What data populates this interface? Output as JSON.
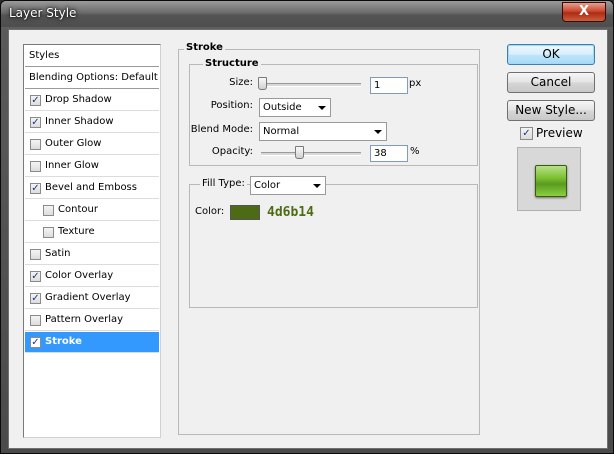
{
  "window": {
    "title": "Layer Style",
    "close_glyph": "X"
  },
  "styles_list": {
    "header": "Styles",
    "items": [
      {
        "label": "Blending Options: Default",
        "has_checkbox": false,
        "checked": false,
        "indent": false,
        "selected": false
      },
      {
        "label": "Drop Shadow",
        "has_checkbox": true,
        "checked": true,
        "indent": false,
        "selected": false
      },
      {
        "label": "Inner Shadow",
        "has_checkbox": true,
        "checked": true,
        "indent": false,
        "selected": false
      },
      {
        "label": "Outer Glow",
        "has_checkbox": true,
        "checked": false,
        "indent": false,
        "selected": false
      },
      {
        "label": "Inner Glow",
        "has_checkbox": true,
        "checked": false,
        "indent": false,
        "selected": false
      },
      {
        "label": "Bevel and Emboss",
        "has_checkbox": true,
        "checked": true,
        "indent": false,
        "selected": false
      },
      {
        "label": "Contour",
        "has_checkbox": true,
        "checked": false,
        "indent": true,
        "selected": false
      },
      {
        "label": "Texture",
        "has_checkbox": true,
        "checked": false,
        "indent": true,
        "selected": false
      },
      {
        "label": "Satin",
        "has_checkbox": true,
        "checked": false,
        "indent": false,
        "selected": false
      },
      {
        "label": "Color Overlay",
        "has_checkbox": true,
        "checked": true,
        "indent": false,
        "selected": false
      },
      {
        "label": "Gradient Overlay",
        "has_checkbox": true,
        "checked": true,
        "indent": false,
        "selected": false
      },
      {
        "label": "Pattern Overlay",
        "has_checkbox": true,
        "checked": false,
        "indent": false,
        "selected": false
      },
      {
        "label": "Stroke",
        "has_checkbox": true,
        "checked": true,
        "indent": false,
        "selected": true
      }
    ],
    "check_glyph": "✓"
  },
  "stroke": {
    "section_title": "Stroke",
    "structure_title": "Structure",
    "size": {
      "label": "Size:",
      "value": "1",
      "unit": "px"
    },
    "position": {
      "label": "Position:",
      "value": "Outside"
    },
    "blend_mode": {
      "label": "Blend Mode:",
      "value": "Normal"
    },
    "opacity": {
      "label": "Opacity:",
      "value": "38",
      "unit": "%"
    },
    "fill_type": {
      "label": "Fill Type:",
      "value": "Color"
    },
    "color": {
      "label": "Color:",
      "hex": "4d6b14",
      "swatch": "#4d6b14"
    }
  },
  "buttons": {
    "ok": "OK",
    "cancel": "Cancel",
    "new_style": "New Style..."
  },
  "preview": {
    "label": "Preview",
    "checked": true
  }
}
